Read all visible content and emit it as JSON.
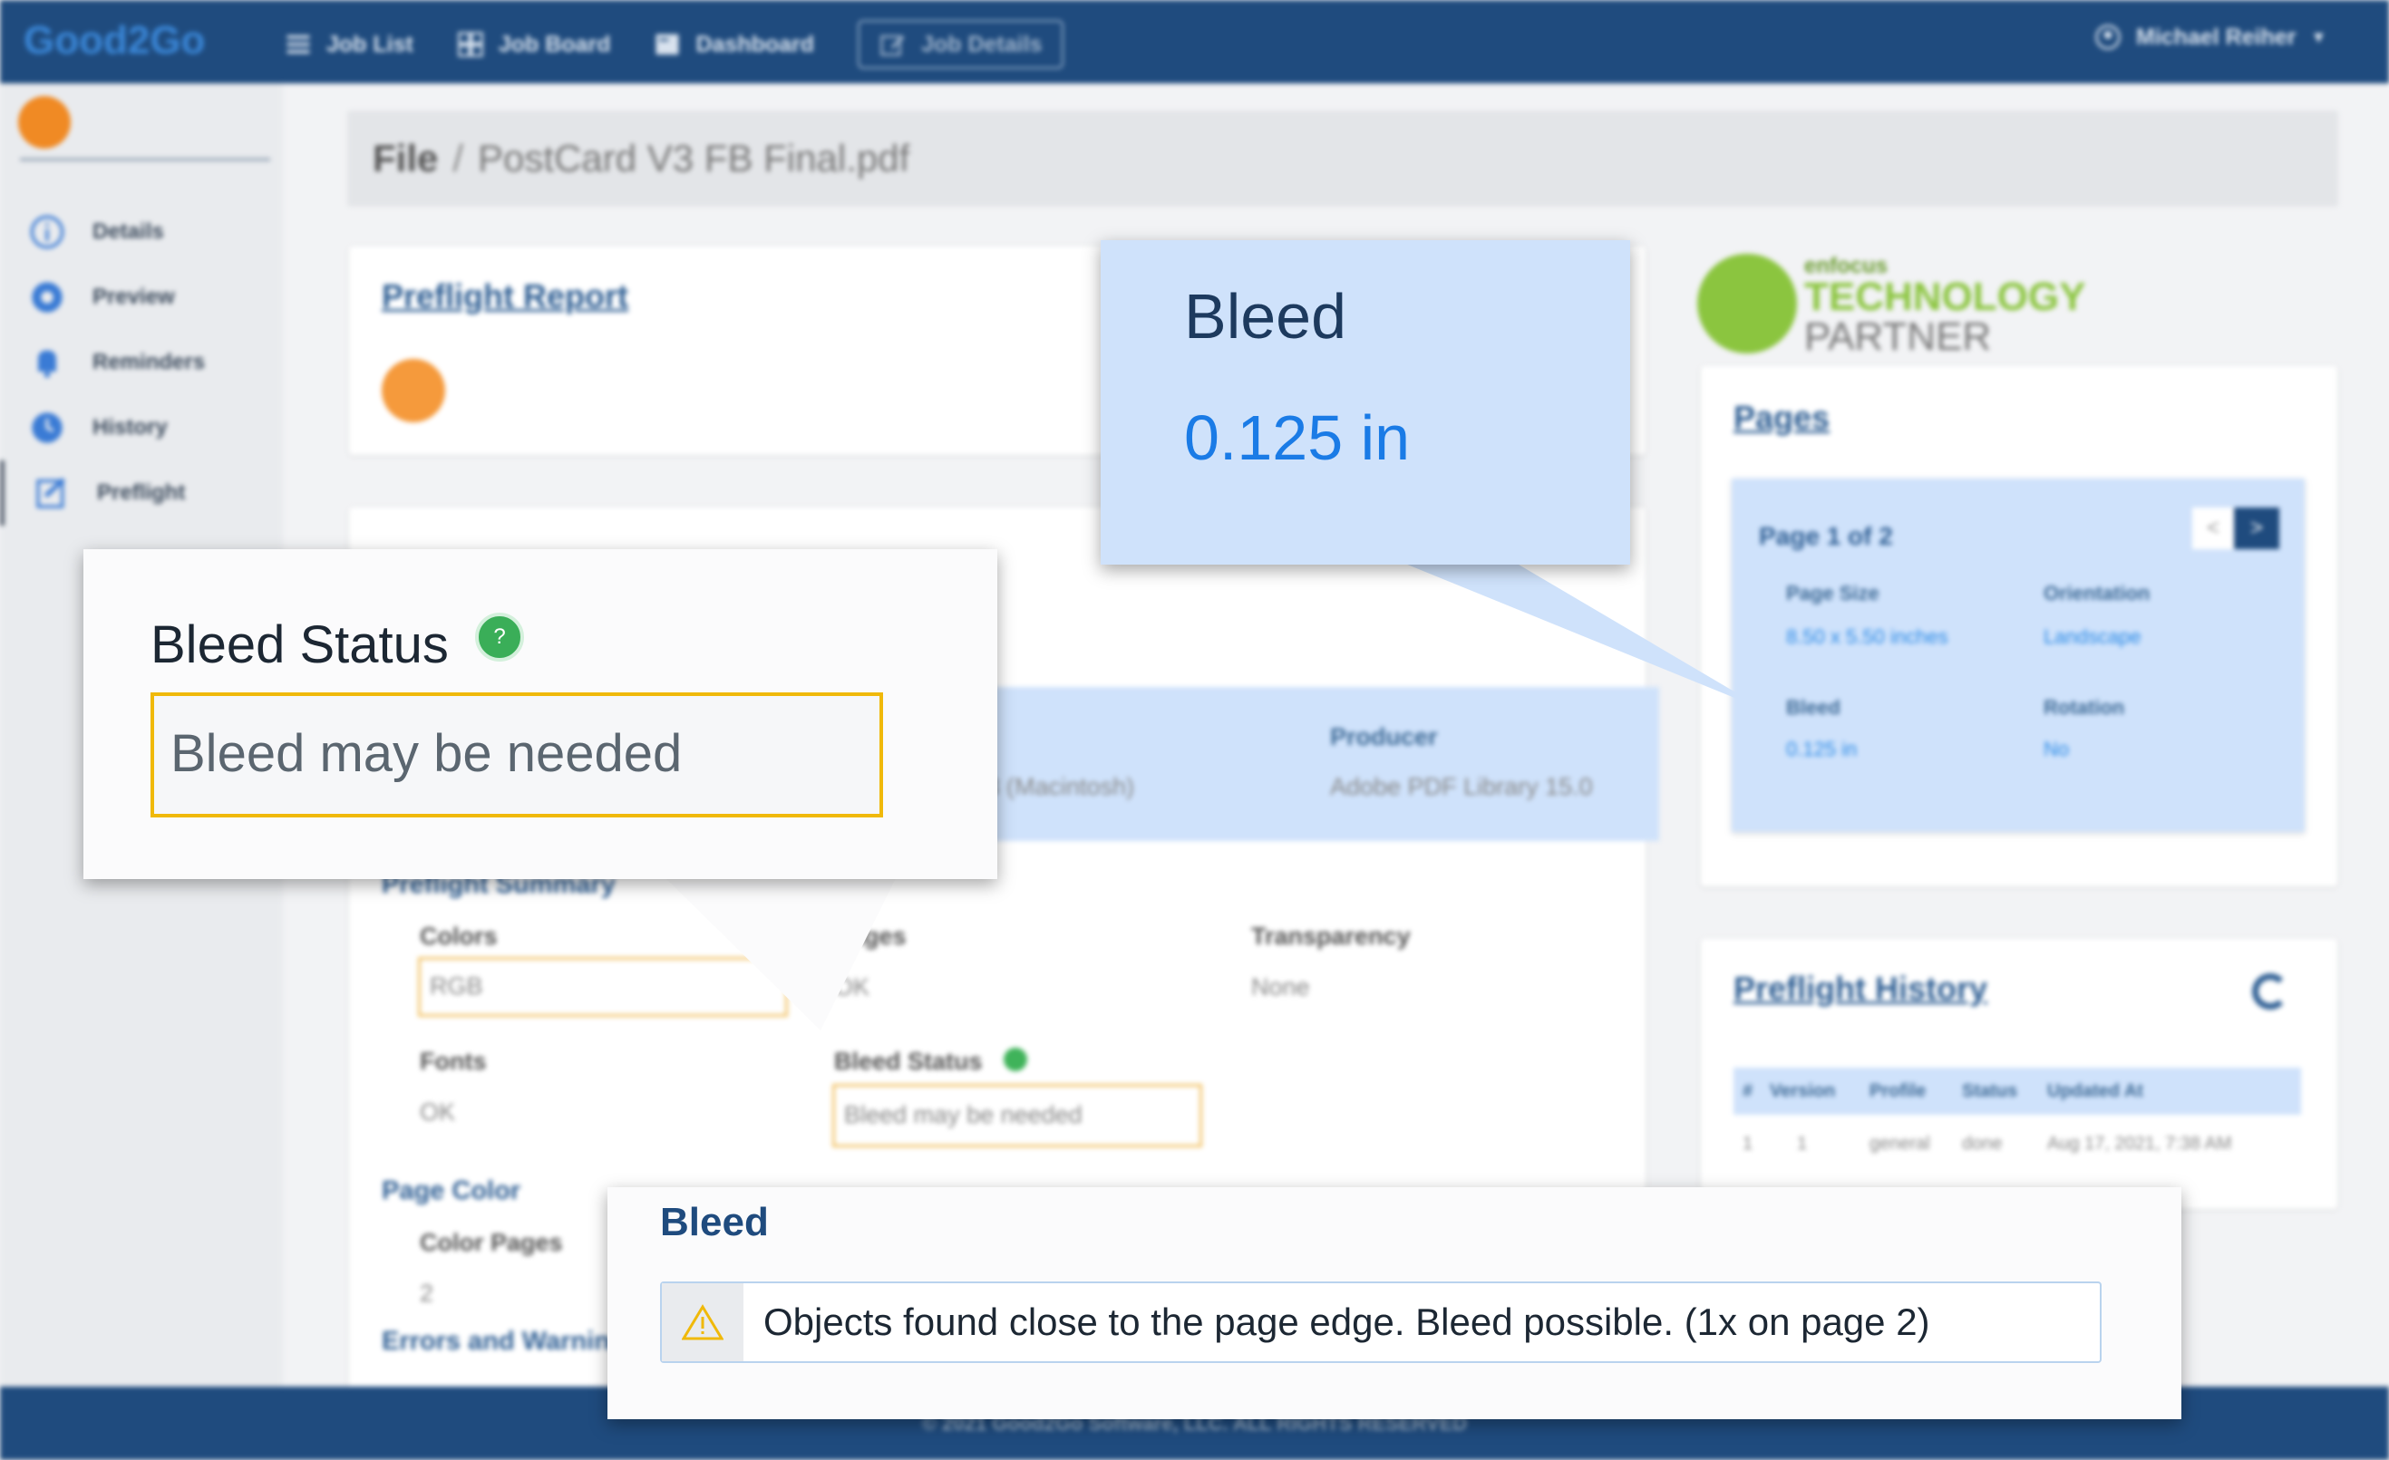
{
  "navbar": {
    "logo": "Good2Go",
    "items": [
      {
        "label": "Job List",
        "icon": "list-icon"
      },
      {
        "label": "Job Board",
        "icon": "board-icon"
      },
      {
        "label": "Dashboard",
        "icon": "dashboard-icon"
      },
      {
        "label": "Job Details",
        "icon": "edit-icon"
      }
    ],
    "user": "Michael Reiher"
  },
  "sidebar": {
    "items": [
      {
        "label": "Details",
        "icon": "info-icon"
      },
      {
        "label": "Preview",
        "icon": "eye-icon"
      },
      {
        "label": "Reminders",
        "icon": "bell-icon"
      },
      {
        "label": "History",
        "icon": "history-icon"
      },
      {
        "label": "Preflight",
        "icon": "preflight-icon"
      }
    ]
  },
  "breadcrumb": {
    "root": "File",
    "separator": "/",
    "current": "PostCard V3 FB Final.pdf"
  },
  "preflight_report": {
    "title": "Preflight Report"
  },
  "file_info": {
    "creator_value": "6.3 (Macintosh)",
    "producer_label": "Producer",
    "producer_value": "Adobe PDF Library 15.0"
  },
  "summary": {
    "title": "Preflight Summary",
    "colors_label": "Colors",
    "colors_value": "RGB",
    "pages_label": "Pages",
    "pages_value": "OK",
    "transparency_label": "Transparency",
    "transparency_value": "None",
    "fonts_label": "Fonts",
    "fonts_value": "OK",
    "bleed_status_label": "Bleed Status",
    "bleed_status_value": "Bleed may be needed",
    "page_color_title": "Page Color",
    "color_pages_label": "Color Pages",
    "color_pages_value": "2",
    "errors_title": "Errors and Warnings"
  },
  "partner": {
    "line1": "enfocus",
    "line2": "TECHNOLOGY",
    "line3": "PARTNER"
  },
  "pages": {
    "title": "Pages",
    "page_indicator": "Page 1 of 2",
    "page_size_label": "Page Size",
    "page_size_value": "8.50 x 5.50 inches",
    "orientation_label": "Orientation",
    "orientation_value": "Landscape",
    "bleed_label": "Bleed",
    "bleed_value": "0.125 in",
    "rotation_label": "Rotation",
    "rotation_value": "No",
    "prev": "<",
    "next": ">"
  },
  "history": {
    "title": "Preflight History",
    "columns": [
      "#",
      "Version",
      "Profile",
      "Status",
      "Updated At"
    ],
    "rows": [
      [
        "1",
        "1",
        "general",
        "done",
        "Aug 17, 2021, 7:38 AM"
      ]
    ]
  },
  "footer": {
    "text": "© 2021 Good2Go Software, LLC. ALL RIGHTS RESERVED"
  },
  "callout_bleed": {
    "title": "Bleed",
    "value": "0.125 in"
  },
  "callout_status": {
    "title": "Bleed Status",
    "value": "Bleed may be needed",
    "help": "?"
  },
  "callout_warning": {
    "title": "Bleed",
    "message": "Objects found close to the page edge. Bleed possible. (1x on page 2)"
  },
  "colors": {
    "navbar": "#1f4b7e",
    "accent_orange": "#f08a24",
    "callout_blue": "#cfe2fb",
    "warning_yellow": "#f0b90a"
  }
}
